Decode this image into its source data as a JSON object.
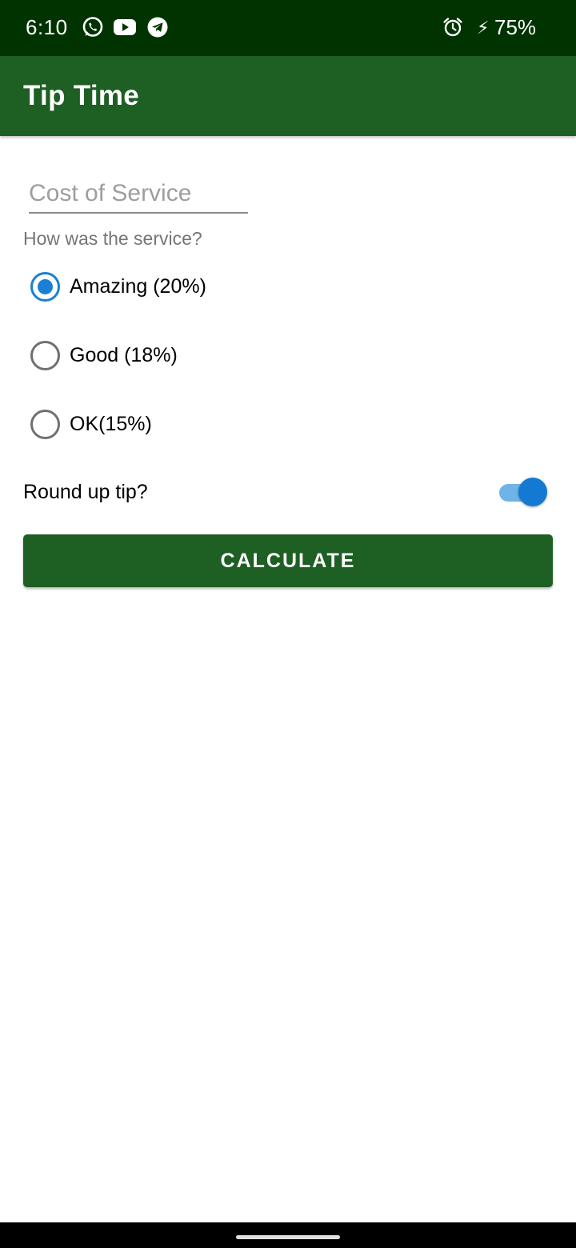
{
  "status_bar": {
    "time": "6:10",
    "notification_icons": [
      "whatsapp-icon",
      "youtube-icon",
      "telegram-icon"
    ],
    "alarm_icon": "alarm-icon",
    "charging_icon": "⚡",
    "battery": "75%"
  },
  "app_bar": {
    "title": "Tip Time",
    "color": "#1e5f23"
  },
  "form": {
    "cost_placeholder": "Cost of Service",
    "cost_value": "",
    "question": "How was the service?",
    "options": [
      {
        "label": "Amazing (20%)",
        "selected": true
      },
      {
        "label": "Good (18%)",
        "selected": false
      },
      {
        "label": "OK(15%)",
        "selected": false
      }
    ],
    "round_up_label": "Round up tip?",
    "round_up_on": true,
    "accent_color": "#1a80d4",
    "calculate_label": "CALCULATE"
  }
}
